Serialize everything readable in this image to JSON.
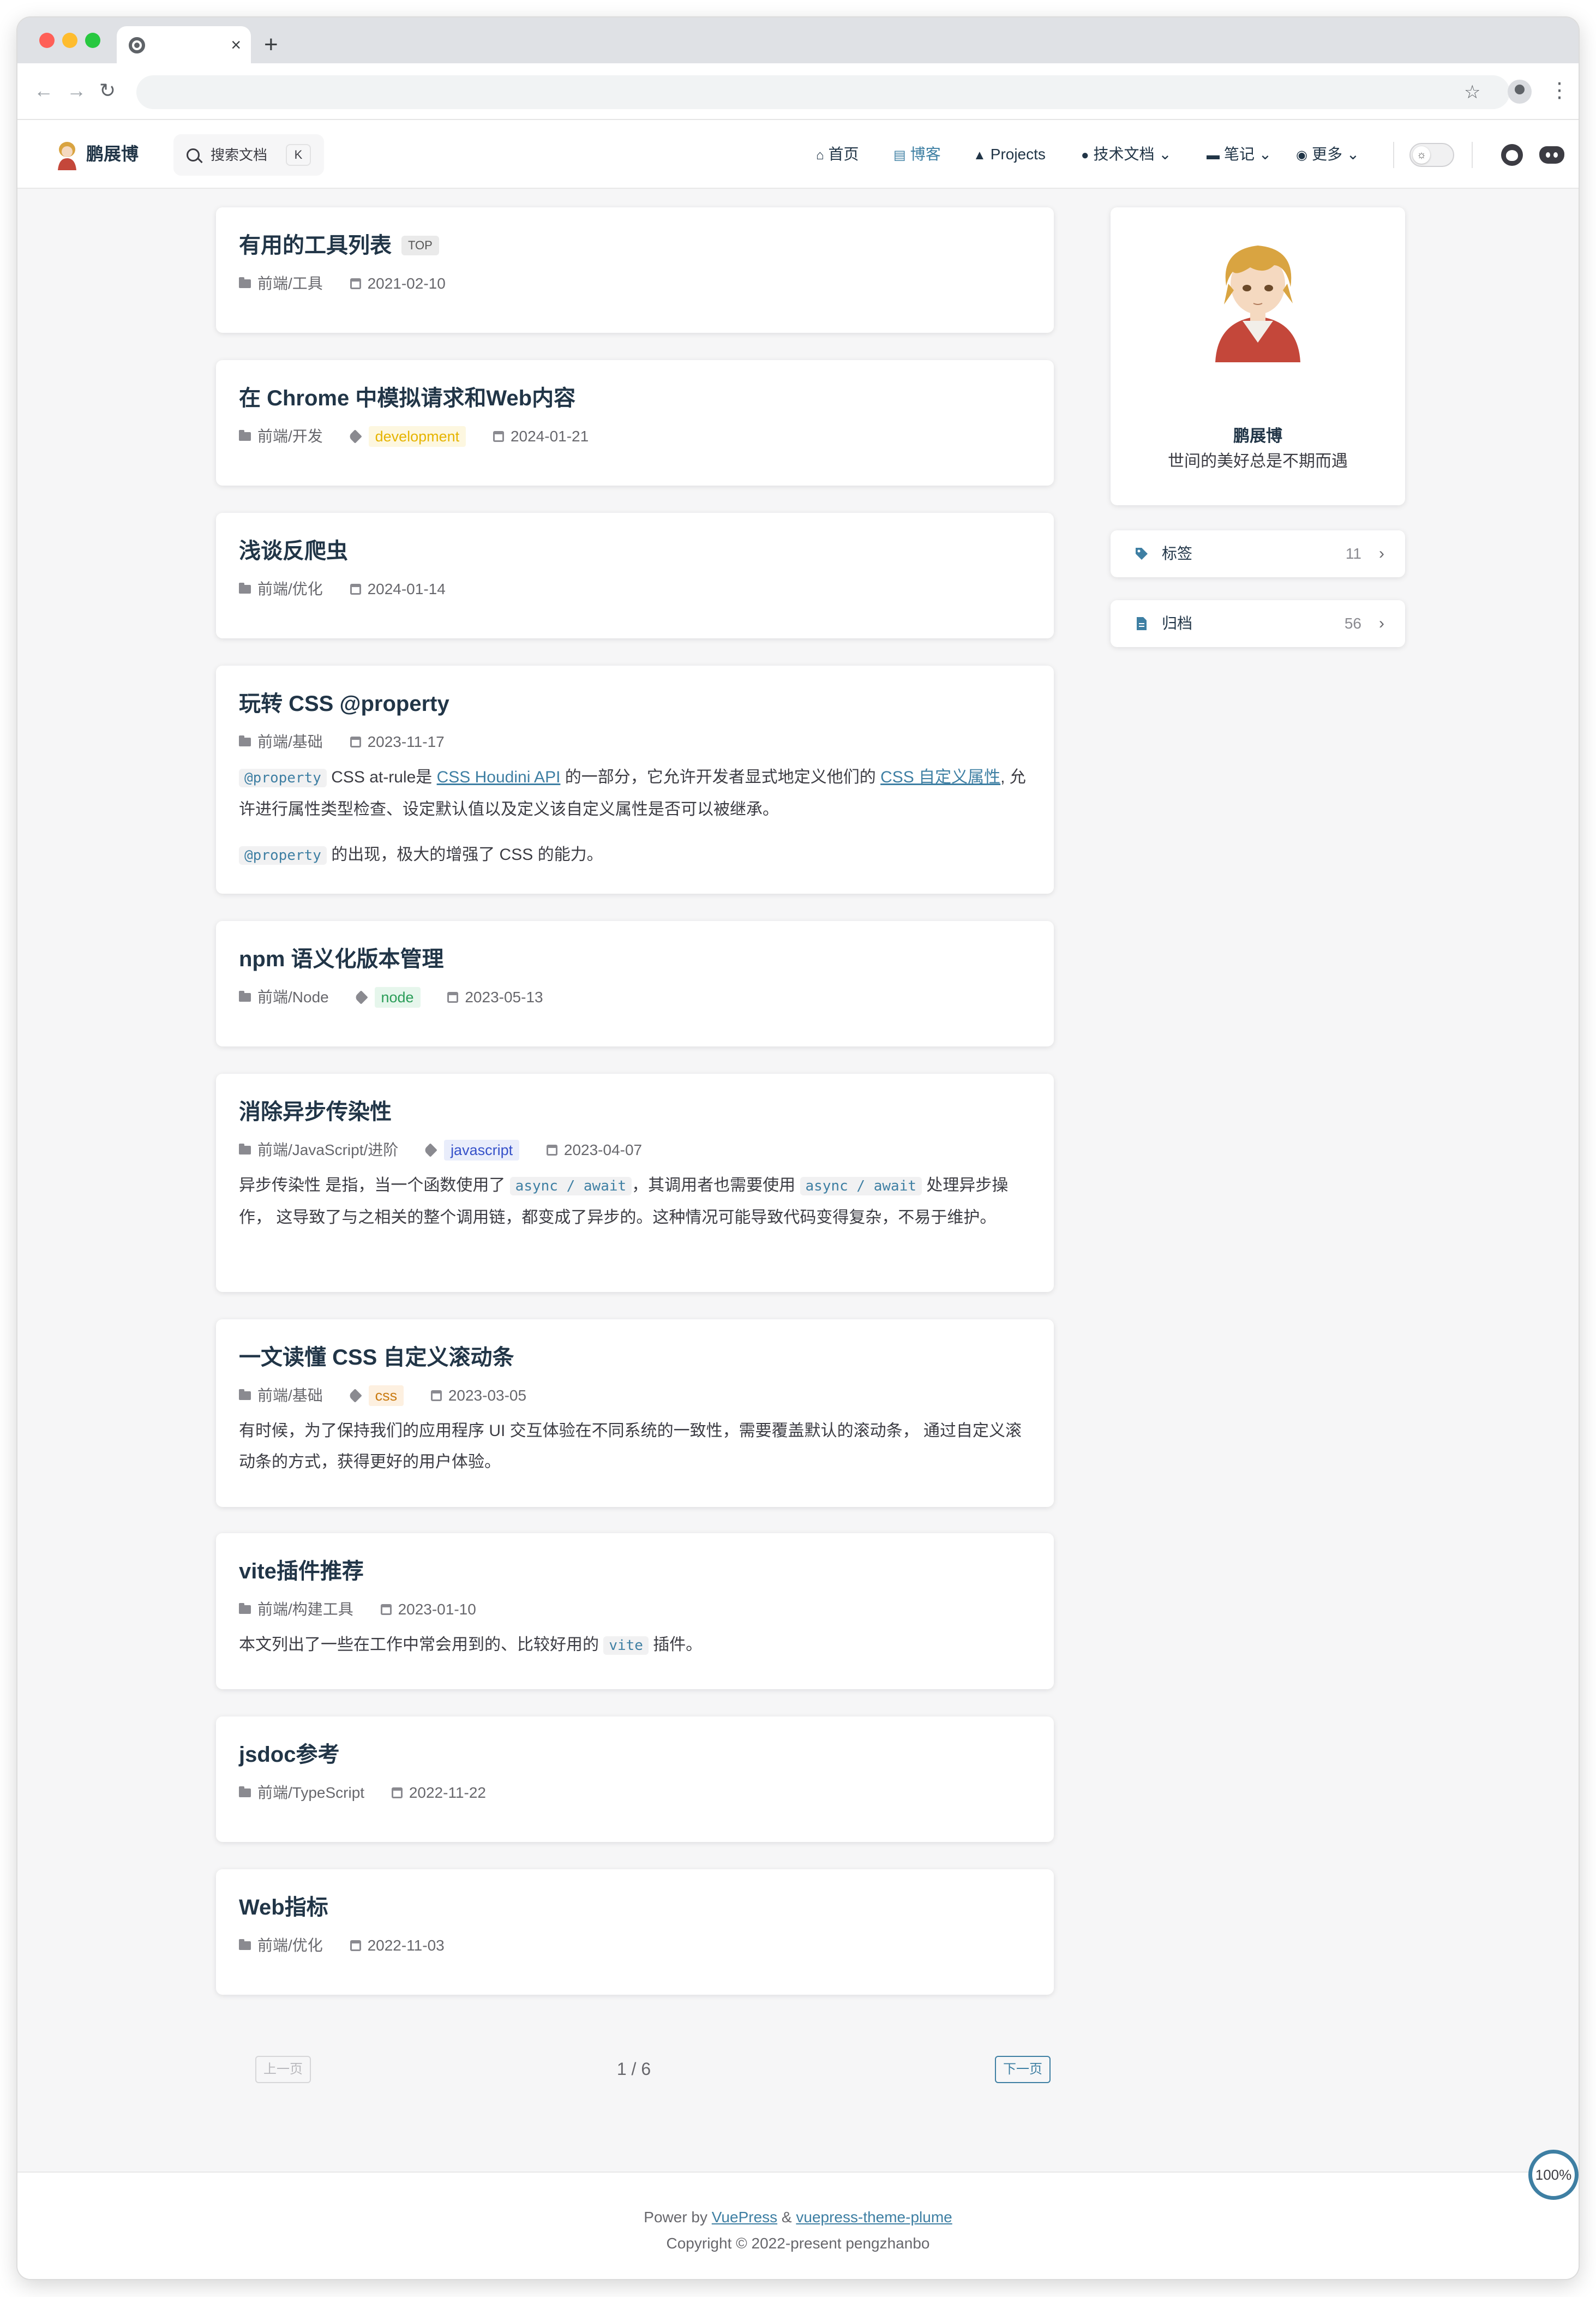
{
  "browser": {
    "tab_close": "×",
    "new_tab": "+",
    "back": "←",
    "forward": "→",
    "reload": "↻",
    "bookmark": "☆",
    "menu": "⋮"
  },
  "site": {
    "title": "鹏展博",
    "search_placeholder": "搜索文档",
    "search_shortcut": "K"
  },
  "nav": {
    "home": "首页",
    "blog": "博客",
    "projects": "Projects",
    "tech_docs": "技术文档",
    "notes": "笔记",
    "more": "更多"
  },
  "posts": [
    {
      "title": "有用的工具列表",
      "badge": "TOP",
      "category": "前端/工具",
      "date": "2021-02-10"
    },
    {
      "title": "在 Chrome 中模拟请求和Web内容",
      "category": "前端/开发",
      "tag": "development",
      "date": "2024-01-21"
    },
    {
      "title": "浅谈反爬虫",
      "category": "前端/优化",
      "date": "2024-01-14"
    },
    {
      "title": "玩转 CSS @property",
      "category": "前端/基础",
      "date": "2023-11-17",
      "excerpt": {
        "code1": "@property",
        "t1": " CSS at-rule是 ",
        "link1": "CSS Houdini API",
        "t2": " 的一部分，它允许开发者显式地定义他们的 ",
        "link2": "CSS 自定义属性",
        "t3": ", 允许进行属性类型检查、设定默认值以及定义该自定义属性是否可以被继承。",
        "code2": "@property",
        "t4": " 的出现，极大的增强了 CSS 的能力。"
      }
    },
    {
      "title": "npm 语义化版本管理",
      "category": "前端/Node",
      "tag": "node",
      "date": "2023-05-13"
    },
    {
      "title": "消除异步传染性",
      "category": "前端/JavaScript/进阶",
      "tag": "javascript",
      "date": "2023-04-07",
      "excerpt": {
        "t1": "异步传染性 是指，当一个函数使用了 ",
        "code1": "async / await",
        "t2": "，其调用者也需要使用 ",
        "code2": "async / await",
        "t3": " 处理异步操作， 这导致了与之相关的整个调用链，都变成了异步的。这种情况可能导致代码变得复杂，不易于维护。"
      }
    },
    {
      "title": "一文读懂 CSS 自定义滚动条",
      "category": "前端/基础",
      "tag": "css",
      "date": "2023-03-05",
      "excerpt": {
        "t1": "有时候，为了保持我们的应用程序 UI 交互体验在不同系统的一致性，需要覆盖默认的滚动条， 通过自定义滚动条的方式，获得更好的用户体验。"
      }
    },
    {
      "title": "vite插件推荐",
      "category": "前端/构建工具",
      "date": "2023-01-10",
      "excerpt": {
        "t1": "本文列出了一些在工作中常会用到的、比较好用的 ",
        "code1": "vite",
        "t2": " 插件。"
      }
    },
    {
      "title": "jsdoc参考",
      "category": "前端/TypeScript",
      "date": "2022-11-22"
    },
    {
      "title": "Web指标",
      "category": "前端/优化",
      "date": "2022-11-03"
    }
  ],
  "tag_colors": {
    "development": {
      "bg": "#fdf7e0",
      "fg": "#e6b400"
    },
    "node": {
      "bg": "#e6f6ec",
      "fg": "#2a9d58"
    },
    "javascript": {
      "bg": "#e9edfb",
      "fg": "#3651c9"
    },
    "css": {
      "bg": "#fdf0e0",
      "fg": "#c97a10"
    }
  },
  "pagination": {
    "prev": "上一页",
    "current": "1 / 6",
    "next": "下一页"
  },
  "sidebar": {
    "author": "鹏展博",
    "motto": "世间的美好总是不期而遇",
    "tags_label": "标签",
    "tags_count": "11",
    "archive_label": "归档",
    "archive_count": "56",
    "chevron": "›"
  },
  "footer": {
    "power_prefix": "Power by ",
    "vuepress": "VuePress",
    "amp": " & ",
    "theme": "vuepress-theme-plume",
    "copyright": "Copyright © 2022-present pengzhanbo"
  },
  "zoom": "100%",
  "accent_color": "#3e7fa3"
}
